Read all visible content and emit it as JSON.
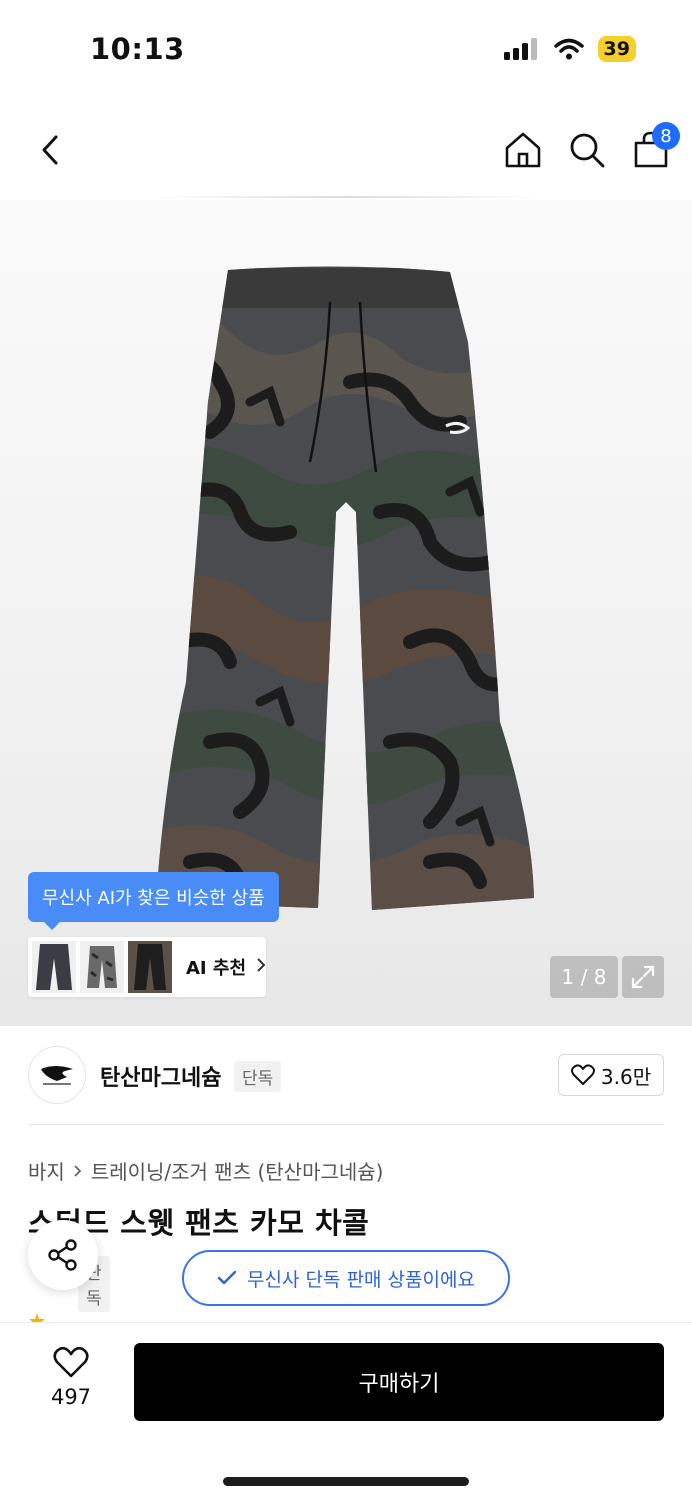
{
  "status_bar": {
    "time": "10:13",
    "battery": "39"
  },
  "header": {
    "cart_count": "8"
  },
  "hero": {
    "ai_tooltip": "무신사 AI가 찾은 비슷한 상품",
    "ai_recommend_label": "AI 추천",
    "image_counter": "1 / 8"
  },
  "brand": {
    "name": "탄산마그네슘",
    "tag": "단독",
    "likes": "3.6만"
  },
  "breadcrumb": {
    "category": "바지",
    "subcategory": "트레이닝/조거 팬츠 (탄산마그네슘)"
  },
  "product": {
    "title": "스터드 스웻 팬츠 카모 차콜",
    "exclusive_tag": "단독",
    "exclusive_notice": "무신사 단독 판매 상품이에요"
  },
  "bottom_bar": {
    "wish_count": "497",
    "buy_label": "구매하기"
  }
}
